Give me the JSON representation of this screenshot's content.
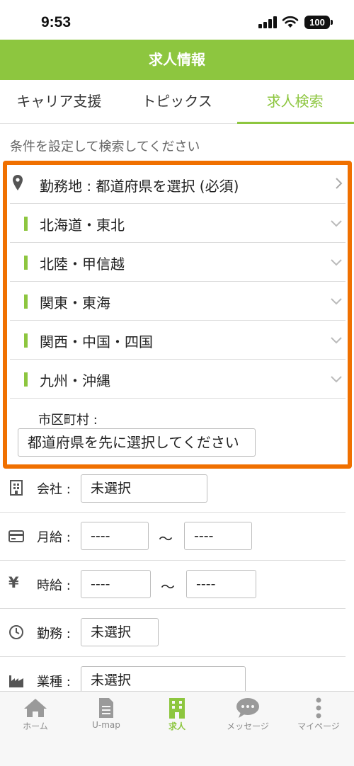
{
  "status_bar": {
    "time": "9:53",
    "battery": "100"
  },
  "header": {
    "title": "求人情報"
  },
  "tabs": [
    {
      "label": "キャリア支援",
      "active": false
    },
    {
      "label": "トピックス",
      "active": false
    },
    {
      "label": "求人検索",
      "active": true
    }
  ],
  "hint": "条件を設定して検索してください",
  "location": {
    "label": "勤務地 : 都道府県を選択 (必須)",
    "regions": [
      "北海道・東北",
      "北陸・甲信越",
      "関東・東海",
      "関西・中国・四国",
      "九州・沖縄"
    ],
    "city_label": "市区町村 :",
    "city_placeholder": "都道府県を先に選択してください"
  },
  "filters": {
    "company": {
      "label": "会社 :",
      "value": "未選択"
    },
    "monthly_salary": {
      "label": "月給 :",
      "min": "----",
      "sep": "〜",
      "max": "----"
    },
    "hourly_wage": {
      "icon_char": "¥",
      "label": "時給 :",
      "min": "----",
      "sep": "〜",
      "max": "----"
    },
    "work_type": {
      "label": "勤務 :",
      "value": "未選択"
    },
    "industry": {
      "label": "業種 :",
      "value": "未選択"
    }
  },
  "bottom_nav": [
    {
      "label": "ホーム",
      "icon": "home-icon",
      "active": false
    },
    {
      "label": "U-map",
      "icon": "document-icon",
      "active": false
    },
    {
      "label": "求人",
      "icon": "building-icon",
      "active": true
    },
    {
      "label": "メッセージ",
      "icon": "chat-icon",
      "active": false
    },
    {
      "label": "マイページ",
      "icon": "more-vertical-icon",
      "active": false
    }
  ],
  "colors": {
    "brand_green": "#8dc63f",
    "highlight_orange": "#f07000"
  }
}
